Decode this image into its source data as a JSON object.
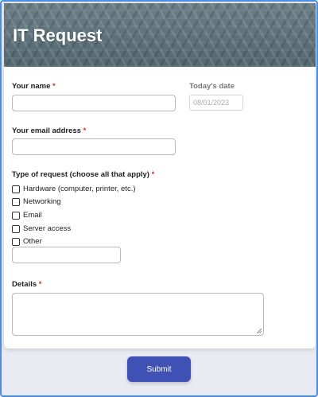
{
  "form": {
    "title": "IT Request",
    "name_label": "Your name",
    "date_label": "Today's date",
    "date_value": "08/01/2023",
    "email_label": "Your email address",
    "required_mark": "*",
    "request_type_label": "Type of request (choose all that apply)",
    "options": [
      {
        "label": "Hardware (computer, printer, etc.)",
        "checked": false
      },
      {
        "label": "Networking",
        "checked": false
      },
      {
        "label": "Email",
        "checked": false
      },
      {
        "label": "Server access",
        "checked": false
      },
      {
        "label": "Other",
        "checked": false
      }
    ],
    "details_label": "Details",
    "submit_label": "Submit"
  },
  "colors": {
    "accent": "#3f51b5",
    "required": "#d93025",
    "frame": "#4a90e2",
    "banner": "#5a6e76"
  }
}
